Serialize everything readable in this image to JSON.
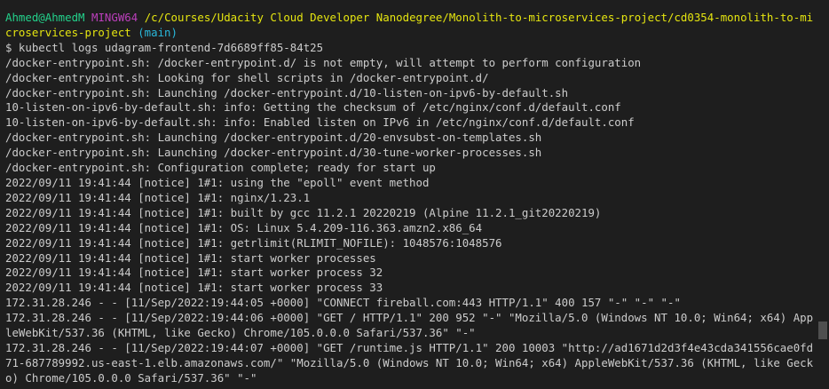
{
  "prompt": {
    "user": "Ahmed@AhmedM",
    "env": "MINGW64",
    "path": "/c/Courses/Udacity Cloud Developer Nanodegree/Monolith-to-microservices-project/cd0354-monolith-to-microservices-project",
    "branch": "(main)",
    "command": "$ kubectl logs udagram-frontend-7d6689ff85-84t25"
  },
  "output_lines": [
    "/docker-entrypoint.sh: /docker-entrypoint.d/ is not empty, will attempt to perform configuration",
    "/docker-entrypoint.sh: Looking for shell scripts in /docker-entrypoint.d/",
    "/docker-entrypoint.sh: Launching /docker-entrypoint.d/10-listen-on-ipv6-by-default.sh",
    "10-listen-on-ipv6-by-default.sh: info: Getting the checksum of /etc/nginx/conf.d/default.conf",
    "10-listen-on-ipv6-by-default.sh: info: Enabled listen on IPv6 in /etc/nginx/conf.d/default.conf",
    "/docker-entrypoint.sh: Launching /docker-entrypoint.d/20-envsubst-on-templates.sh",
    "/docker-entrypoint.sh: Launching /docker-entrypoint.d/30-tune-worker-processes.sh",
    "/docker-entrypoint.sh: Configuration complete; ready for start up",
    "2022/09/11 19:41:44 [notice] 1#1: using the \"epoll\" event method",
    "2022/09/11 19:41:44 [notice] 1#1: nginx/1.23.1",
    "2022/09/11 19:41:44 [notice] 1#1: built by gcc 11.2.1 20220219 (Alpine 11.2.1_git20220219)",
    "2022/09/11 19:41:44 [notice] 1#1: OS: Linux 5.4.209-116.363.amzn2.x86_64",
    "2022/09/11 19:41:44 [notice] 1#1: getrlimit(RLIMIT_NOFILE): 1048576:1048576",
    "2022/09/11 19:41:44 [notice] 1#1: start worker processes",
    "2022/09/11 19:41:44 [notice] 1#1: start worker process 32",
    "2022/09/11 19:41:44 [notice] 1#1: start worker process 33",
    "172.31.28.246 - - [11/Sep/2022:19:44:05 +0000] \"CONNECT fireball.com:443 HTTP/1.1\" 400 157 \"-\" \"-\" \"-\"",
    "172.31.28.246 - - [11/Sep/2022:19:44:06 +0000] \"GET / HTTP/1.1\" 200 952 \"-\" \"Mozilla/5.0 (Windows NT 10.0; Win64; x64) AppleWebKit/537.36 (KHTML, like Gecko) Chrome/105.0.0.0 Safari/537.36\" \"-\"",
    "172.31.28.246 - - [11/Sep/2022:19:44:07 +0000] \"GET /runtime.js HTTP/1.1\" 200 10003 \"http://ad1671d2d3f4e43cda341556cae0fd71-687789992.us-east-1.elb.amazonaws.com/\" \"Mozilla/5.0 (Windows NT 10.0; Win64; x64) AppleWebKit/537.36 (KHTML, like Gecko) Chrome/105.0.0.0 Safari/537.36\" \"-\""
  ],
  "colors": {
    "background": "#1e1e1e",
    "text": "#cccccc",
    "user": "#23d18b",
    "env": "#bc3fbc",
    "path": "#e5e510",
    "branch": "#29b8db"
  }
}
